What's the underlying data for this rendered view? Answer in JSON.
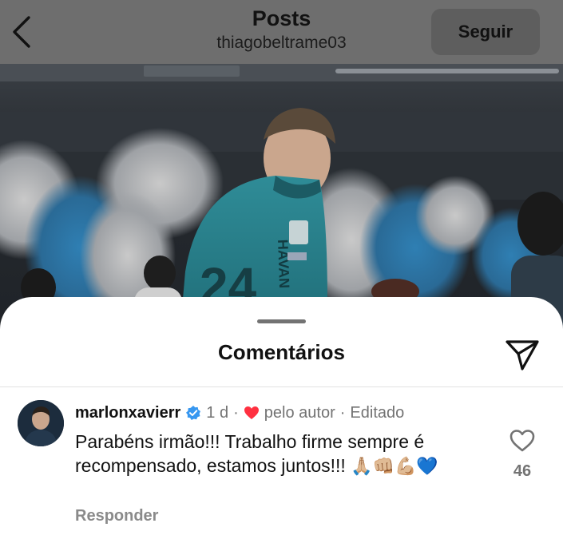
{
  "header": {
    "title": "Posts",
    "username": "thiagobeltrame03",
    "follow_label": "Seguir",
    "back_icon": "chevron-left-icon"
  },
  "post_image": {
    "description": "goalkeeper in teal jersey walking onto stadium pitch with blue and white smoke",
    "jersey_text": [
      "HAVAN",
      "24"
    ]
  },
  "comments_panel": {
    "title": "Comentários",
    "share_icon": "paper-plane-icon",
    "comments": [
      {
        "username": "marlonxavierr",
        "verified": true,
        "time": "1 d",
        "liked_by_author_label": "pelo autor",
        "edited_label": "Editado",
        "text": "Parabéns irmão!!! Trabalho firme sempre é recompensado, estamos juntos!!!",
        "emojis": "🙏🏼👊🏼💪🏼💙",
        "reply_label": "Responder",
        "like_count": "46"
      }
    ]
  },
  "colors": {
    "topbar_bg": "#6e6e6e",
    "follow_bg": "#5e5e5e",
    "verified_blue": "#3797f0",
    "heart_red": "#ff3040",
    "muted_text": "#737373"
  }
}
